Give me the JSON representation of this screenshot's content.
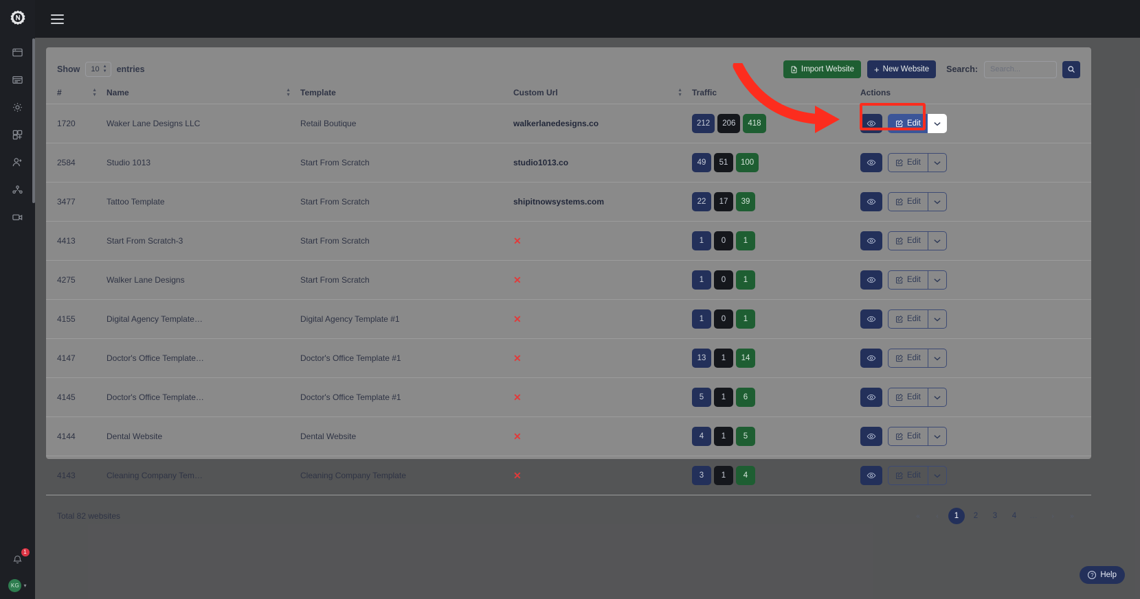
{
  "rail": {
    "logo_icon": "gear-n-logo",
    "items": [
      {
        "icon": "window-icon",
        "name": "sidebar-item-websites"
      },
      {
        "icon": "card-list-icon",
        "name": "sidebar-item-pages"
      },
      {
        "icon": "gear-icon",
        "name": "sidebar-item-settings"
      },
      {
        "icon": "puzzle-icon",
        "name": "sidebar-item-integrations"
      },
      {
        "icon": "user-plus-icon",
        "name": "sidebar-item-users"
      },
      {
        "icon": "share-nodes-icon",
        "name": "sidebar-item-network"
      },
      {
        "icon": "video-camera-icon",
        "name": "sidebar-item-videos"
      }
    ],
    "notification_count": "1",
    "avatar_initials": "KG"
  },
  "topbar": {
    "menu_icon": "hamburger-menu-icon"
  },
  "toolbar": {
    "show_label": "Show",
    "entries_label": "entries",
    "page_size": "10",
    "import_label": "Import Website",
    "import_icon": "file-import-icon",
    "new_label": "New Website",
    "new_icon": "plus-icon",
    "search_label": "Search:",
    "search_placeholder": "Search...",
    "search_value": "",
    "search_button_icon": "search-icon"
  },
  "table": {
    "columns": [
      {
        "key": "id",
        "label": "#",
        "sortable": true
      },
      {
        "key": "name",
        "label": "Name",
        "sortable": true
      },
      {
        "key": "template",
        "label": "Template",
        "sortable": false
      },
      {
        "key": "custom_url",
        "label": "Custom Url",
        "sortable": true
      },
      {
        "key": "traffic",
        "label": "Traffic",
        "sortable": false
      },
      {
        "key": "actions",
        "label": "Actions",
        "sortable": false
      }
    ],
    "row_action_labels": {
      "preview_icon": "eye-icon",
      "edit_label": "Edit",
      "edit_icon": "pencil-square-icon",
      "caret_icon": "chevron-down-icon"
    },
    "no_url_icon": "x-mark-icon",
    "rows": [
      {
        "id": "1720",
        "name": "Waker Lane Designs LLC",
        "template": "Retail Boutique",
        "custom_url": "walkerlanedesigns.co",
        "has_url": true,
        "traffic": [
          "212",
          "206",
          "418"
        ],
        "highlighted": true
      },
      {
        "id": "2584",
        "name": "Studio 1013",
        "template": "Start From Scratch",
        "custom_url": "studio1013.co",
        "has_url": true,
        "traffic": [
          "49",
          "51",
          "100"
        ],
        "highlighted": false
      },
      {
        "id": "3477",
        "name": "Tattoo Template",
        "template": "Start From Scratch",
        "custom_url": "shipitnowsystems.com",
        "has_url": true,
        "traffic": [
          "22",
          "17",
          "39"
        ],
        "highlighted": false
      },
      {
        "id": "4413",
        "name": "Start From Scratch-3",
        "template": "Start From Scratch",
        "custom_url": "",
        "has_url": false,
        "traffic": [
          "1",
          "0",
          "1"
        ],
        "highlighted": false
      },
      {
        "id": "4275",
        "name": "Walker Lane Designs",
        "template": "Start From Scratch",
        "custom_url": "",
        "has_url": false,
        "traffic": [
          "1",
          "0",
          "1"
        ],
        "highlighted": false
      },
      {
        "id": "4155",
        "name": "Digital Agency Template…",
        "template": "Digital Agency Template #1",
        "custom_url": "",
        "has_url": false,
        "traffic": [
          "1",
          "0",
          "1"
        ],
        "highlighted": false
      },
      {
        "id": "4147",
        "name": "Doctor's Office Template…",
        "template": "Doctor's Office Template #1",
        "custom_url": "",
        "has_url": false,
        "traffic": [
          "13",
          "1",
          "14"
        ],
        "highlighted": false
      },
      {
        "id": "4145",
        "name": "Doctor's Office Template…",
        "template": "Doctor's Office Template #1",
        "custom_url": "",
        "has_url": false,
        "traffic": [
          "5",
          "1",
          "6"
        ],
        "highlighted": false
      },
      {
        "id": "4144",
        "name": "Dental Website",
        "template": "Dental Website",
        "custom_url": "",
        "has_url": false,
        "traffic": [
          "4",
          "1",
          "5"
        ],
        "highlighted": false
      },
      {
        "id": "4143",
        "name": "Cleaning Company Tem…",
        "template": "Cleaning Company Template",
        "custom_url": "",
        "has_url": false,
        "traffic": [
          "3",
          "1",
          "4"
        ],
        "highlighted": false
      }
    ]
  },
  "footer": {
    "total_label": "Total 82 websites",
    "pagination": [
      {
        "label": "«",
        "type": "nav",
        "name": "pagination-first"
      },
      {
        "label": "‹",
        "type": "nav",
        "name": "pagination-prev"
      },
      {
        "label": "1",
        "type": "page",
        "active": true,
        "name": "pagination-page-1"
      },
      {
        "label": "2",
        "type": "page",
        "active": false,
        "name": "pagination-page-2"
      },
      {
        "label": "3",
        "type": "page",
        "active": false,
        "name": "pagination-page-3"
      },
      {
        "label": "4",
        "type": "page",
        "active": false,
        "name": "pagination-page-4"
      },
      {
        "label": "…",
        "type": "ellipsis",
        "name": "pagination-ellipsis"
      },
      {
        "label": "›",
        "type": "nav",
        "name": "pagination-next"
      },
      {
        "label": "»",
        "type": "nav",
        "name": "pagination-last"
      }
    ]
  },
  "help": {
    "label": "Help",
    "icon": "question-circle-icon"
  },
  "annotation": {
    "arrow_color": "#fc2d1e",
    "highlight_color": "#fc2d1e",
    "target": "edit-button-row-1"
  },
  "colors": {
    "navy": "#23305a",
    "green": "#1e5e32",
    "dark": "#15171c",
    "rail_bg": "#1d1f24",
    "accent_red": "#fc2d1e"
  }
}
